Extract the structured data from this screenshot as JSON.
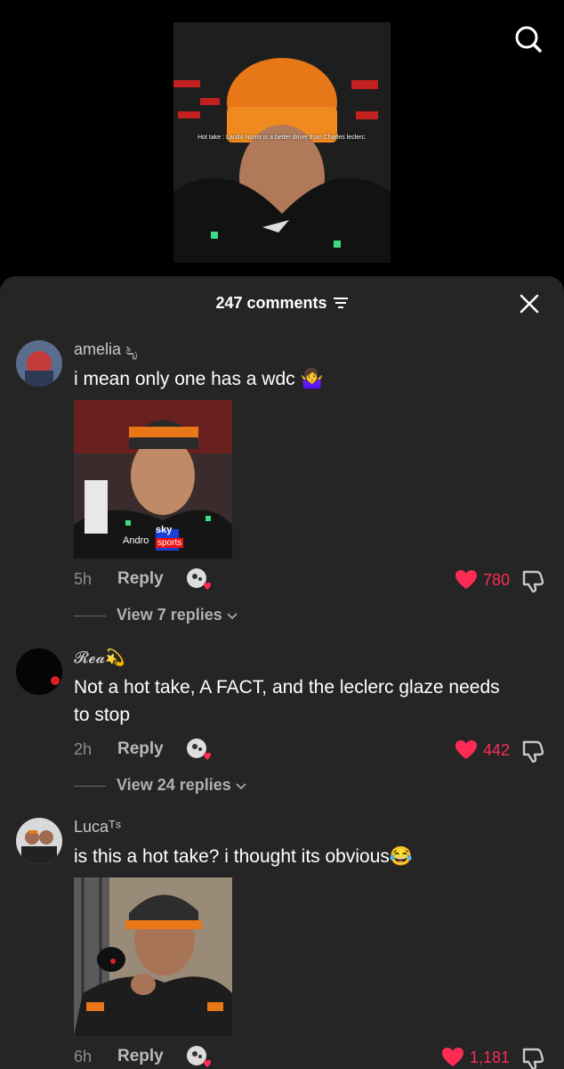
{
  "video": {
    "caption": "Hot take : Lando Norris is a better driver than Charles leclerc."
  },
  "header": {
    "comment_count": "247 comments"
  },
  "comments": [
    {
      "username": "amelia ೬ೃ",
      "text": "i mean only one has a wdc 🤷‍♀️",
      "time": "5h",
      "reply_label": "Reply",
      "likes": "780",
      "view_replies": "View 7 replies"
    },
    {
      "username": "𝓡𝓮𝓪💫",
      "text": "Not a hot take, A FACT, and the leclerc glaze needs to stop",
      "time": "2h",
      "reply_label": "Reply",
      "likes": "442",
      "view_replies": "View 24 replies"
    },
    {
      "username": "Lucaᵀˢ",
      "text": "is this a hot take? i thought its obvious😂",
      "time": "6h",
      "reply_label": "Reply",
      "likes": "1,181"
    }
  ],
  "attachments": {
    "c1_logo1": "sky",
    "c1_logo2": "sports",
    "c1_text": "Andro"
  },
  "colors": {
    "like_red": "#fe2c55",
    "sheet_bg": "#252525",
    "video_bg": "#000000"
  },
  "icons": [
    "search-icon",
    "sort-icon",
    "close-icon",
    "heart-icon",
    "dislike-icon",
    "chevron-down-icon"
  ]
}
